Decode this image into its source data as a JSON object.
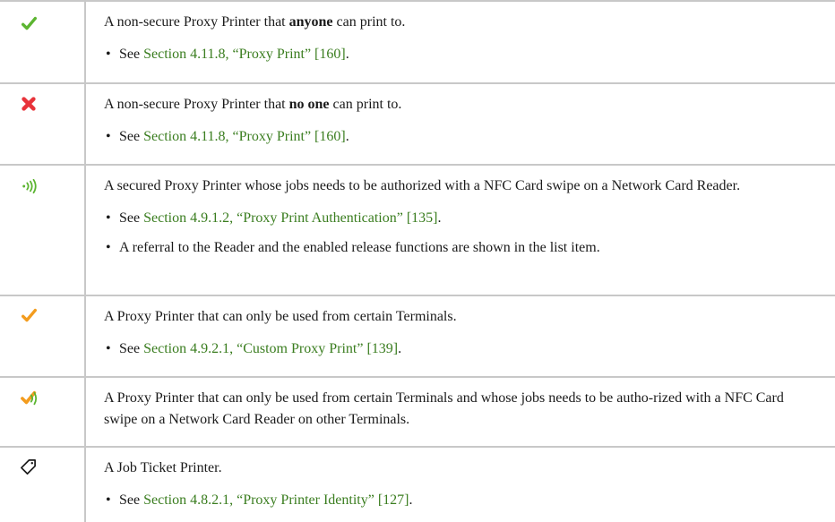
{
  "rows": [
    {
      "icon": "green-check-icon",
      "desc_before": "A non-secure Proxy Printer that ",
      "desc_bold": "anyone",
      "desc_after": " can print to.",
      "see": "See ",
      "link": "Section 4.11.8, “Proxy Print” [160]",
      "end": "."
    },
    {
      "icon": "red-x-icon",
      "desc_before": "A non-secure Proxy Printer that ",
      "desc_bold": "no one",
      "desc_after": " can print to.",
      "see": "See ",
      "link": "Section 4.11.8, “Proxy Print” [160]",
      "end": "."
    },
    {
      "icon": "nfc-signal-icon",
      "desc": "A secured Proxy Printer whose jobs needs to be authorized with a NFC Card swipe on a Network Card Reader.",
      "see": "See ",
      "link": "Section 4.9.1.2, “Proxy Print Authentication” [135]",
      "end": ".",
      "bullet2": "A referral to the Reader and the enabled release functions are shown in the list item."
    },
    {
      "icon": "orange-check-icon",
      "desc": "A Proxy Printer that can only be used from certain Terminals.",
      "see": "See ",
      "link": "Section 4.9.2.1, “Custom Proxy Print” [139]",
      "end": "."
    },
    {
      "icon": "check-nfc-combo-icon",
      "desc": "A Proxy Printer that can only be used from certain Terminals and whose jobs needs to be autho-rized with a NFC Card swipe on a Network Card Reader on other Terminals."
    },
    {
      "icon": "tag-icon",
      "desc": "A Job Ticket Printer.",
      "see": "See ",
      "link": "Section 4.8.2.1, “Proxy Printer Identity” [127]",
      "end": "."
    }
  ],
  "colors": {
    "link": "#3a7d1f",
    "green": "#5cb531",
    "red": "#e8333a",
    "orange": "#f39c1e",
    "border": "#c8c8c8"
  }
}
